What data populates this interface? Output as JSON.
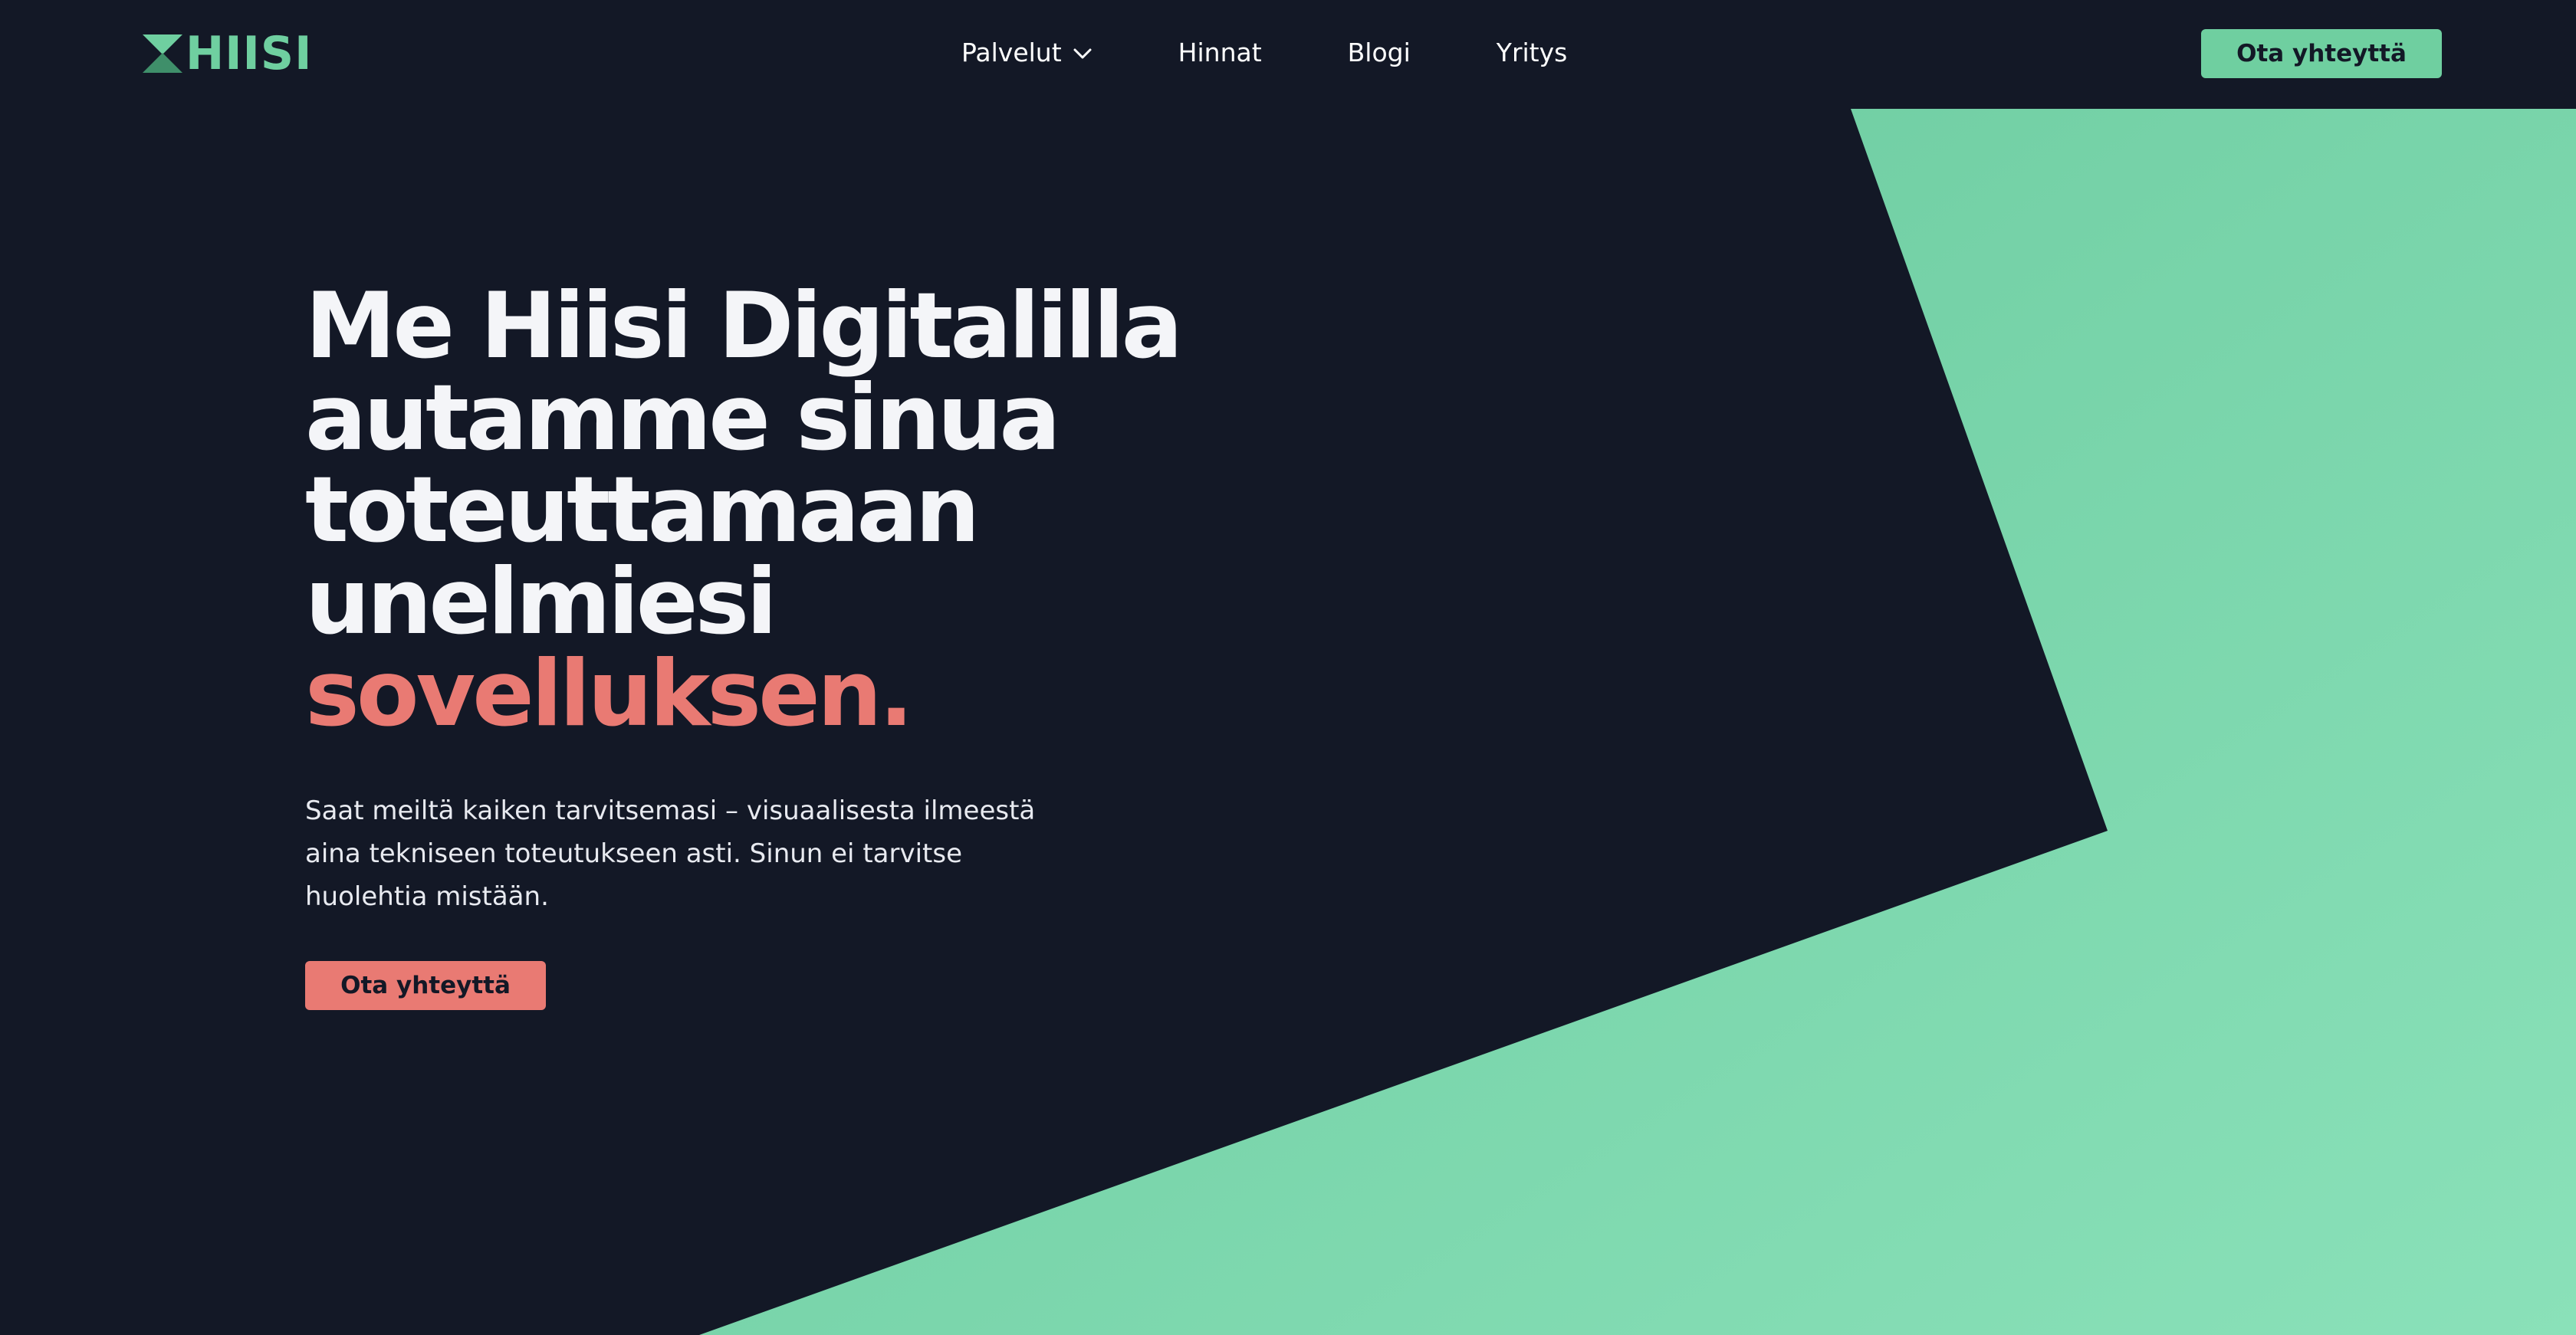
{
  "brand": {
    "name": "HIISI",
    "logo_icon": "hiisi-logo-mark",
    "color": "#6fcfa0"
  },
  "nav": {
    "items": [
      {
        "label": "Palvelut",
        "has_dropdown": true
      },
      {
        "label": "Hinnat",
        "has_dropdown": false
      },
      {
        "label": "Blogi",
        "has_dropdown": false
      },
      {
        "label": "Yritys",
        "has_dropdown": false
      }
    ],
    "dropdown_icon": "chevron-down-icon"
  },
  "header": {
    "cta_label": "Ota yhteyttä"
  },
  "hero": {
    "title_lines": [
      "Me Hiisi Digitalilla",
      "autamme sinua",
      "toteuttamaan",
      "unelmiesi"
    ],
    "title_accent": "sovelluksen.",
    "description": "Saat meiltä kaiken tarvitsemasi – visuaalisesta ilmeestä aina tekniseen toteutukseen asti. Sinun ei tarvitse huolehtia mistään.",
    "cta_label": "Ota yhteyttä"
  },
  "colors": {
    "background": "#131826",
    "accent_green": "#6fcfa0",
    "accent_coral": "#e97a73",
    "text_light": "#f4f5f8"
  }
}
